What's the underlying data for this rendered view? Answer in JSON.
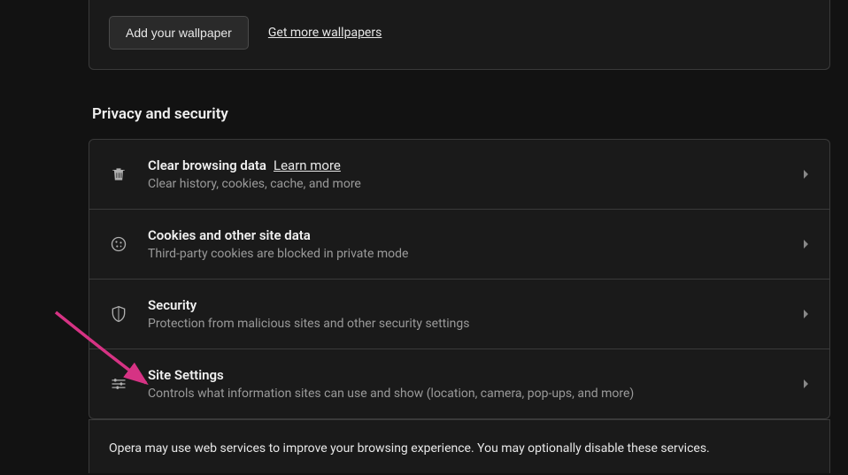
{
  "wallpaper": {
    "add_button": "Add your wallpaper",
    "get_more_link": "Get more wallpapers"
  },
  "privacy_section": {
    "heading": "Privacy and security",
    "items": [
      {
        "title": "Clear browsing data",
        "learn_more": "Learn more",
        "desc": "Clear history, cookies, cache, and more"
      },
      {
        "title": "Cookies and other site data",
        "desc": "Third-party cookies are blocked in private mode"
      },
      {
        "title": "Security",
        "desc": "Protection from malicious sites and other security settings"
      },
      {
        "title": "Site Settings",
        "desc": "Controls what information sites can use and show (location, camera, pop-ups, and more)"
      }
    ],
    "footer": "Opera may use web services to improve your browsing experience. You may optionally disable these services."
  }
}
